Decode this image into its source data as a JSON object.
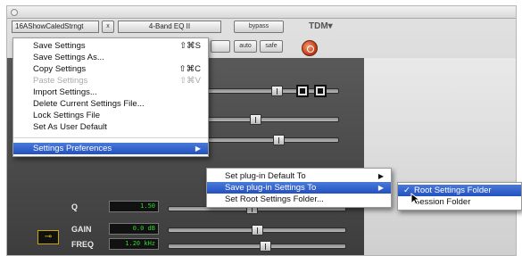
{
  "plugin": {
    "preset_name": "16AShowCaledStrngt",
    "preset_arrow": "x",
    "plugin_name": "4-Band EQ II",
    "bypass_label": "bypass",
    "brand": "TDM▾",
    "auto_label": "auto",
    "safe_label": "safe",
    "params": [
      {
        "label": "Q",
        "value": "1.50"
      },
      {
        "label": "GAIN",
        "value": "0.0 dB"
      },
      {
        "label": "FREQ",
        "value": "1.20 kHz"
      }
    ]
  },
  "settings_menu": {
    "items": [
      {
        "label": "Save Settings",
        "shortcut": "⇧⌘S"
      },
      {
        "label": "Save Settings As...",
        "shortcut": ""
      },
      {
        "label": "Copy Settings",
        "shortcut": "⇧⌘C"
      },
      {
        "label": "Paste Settings",
        "shortcut": "⇧⌘V"
      },
      {
        "label": "Import Settings...",
        "shortcut": ""
      },
      {
        "label": "Delete Current Settings File...",
        "shortcut": ""
      },
      {
        "label": "Lock Settings File",
        "shortcut": ""
      },
      {
        "label": "Set As User Default",
        "shortcut": ""
      },
      {
        "label": "Settings Preferences",
        "shortcut": "▶"
      }
    ]
  },
  "preferences_submenu": {
    "items": [
      {
        "label": "Set plug-in Default To",
        "arrow": "▶"
      },
      {
        "label": "Save plug-in Settings To",
        "arrow": "▶"
      },
      {
        "label": "Set Root Settings Folder...",
        "arrow": ""
      }
    ]
  },
  "save_to_submenu": {
    "items": [
      {
        "label": "Root Settings Folder",
        "check": "✓"
      },
      {
        "label": "Session Folder",
        "check": ""
      }
    ]
  }
}
